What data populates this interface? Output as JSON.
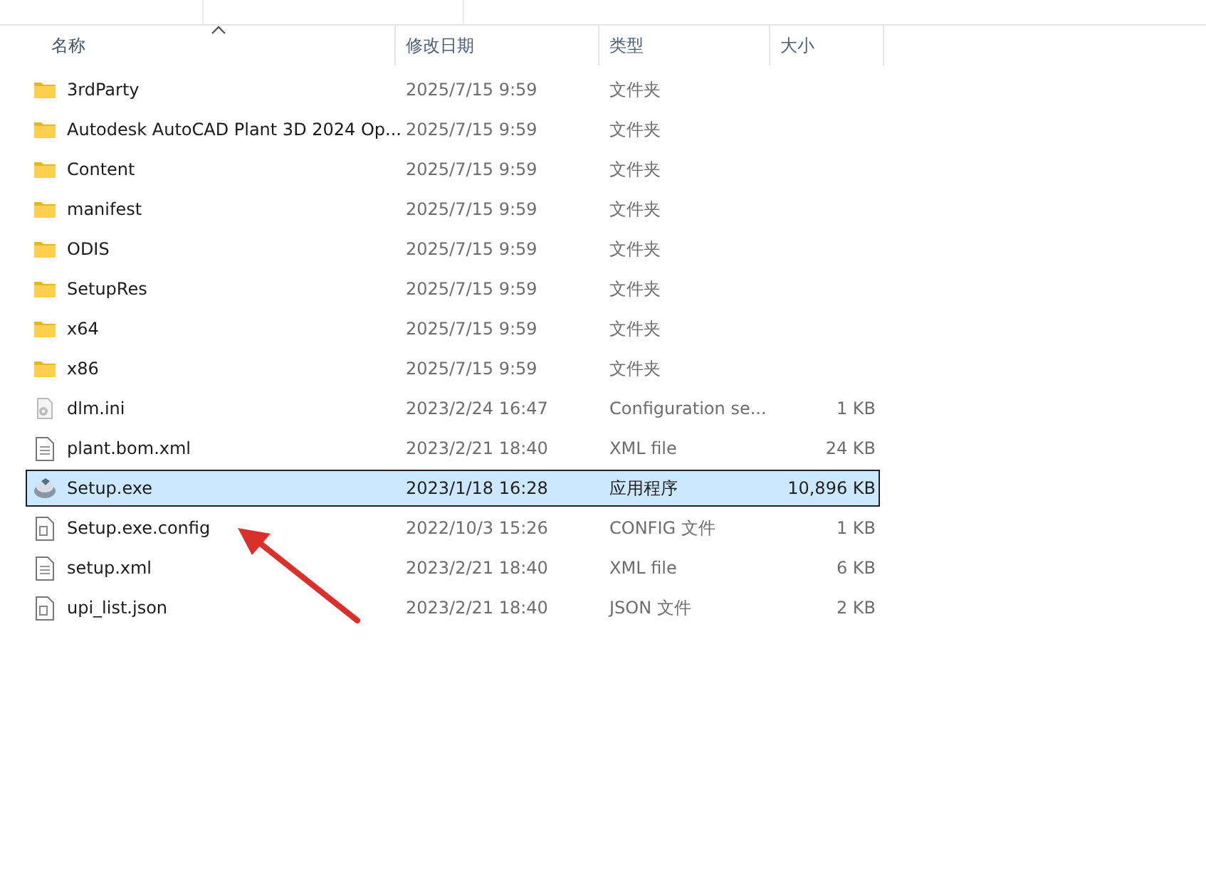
{
  "columns": [
    {
      "label": "名称",
      "sorted": true
    },
    {
      "label": "修改日期",
      "sorted": false
    },
    {
      "label": "类型",
      "sorted": false
    },
    {
      "label": "大小",
      "sorted": false
    }
  ],
  "files": [
    {
      "kind": "folder",
      "name": "3rdParty",
      "date": "2025/7/15 9:59",
      "type": "文件夹",
      "selected": false
    },
    {
      "kind": "folder",
      "name": "Autodesk AutoCAD Plant 3D 2024 Op...",
      "date": "2025/7/15 9:59",
      "type": "文件夹",
      "selected": false
    },
    {
      "kind": "folder",
      "name": "Content",
      "date": "2025/7/15 9:59",
      "type": "文件夹",
      "selected": false
    },
    {
      "kind": "folder",
      "name": "manifest",
      "date": "2025/7/15 9:59",
      "type": "文件夹",
      "selected": false
    },
    {
      "kind": "folder",
      "name": "ODIS",
      "date": "2025/7/15 9:59",
      "type": "文件夹",
      "selected": false
    },
    {
      "kind": "folder",
      "name": "SetupRes",
      "date": "2025/7/15 9:59",
      "type": "文件夹",
      "selected": false
    },
    {
      "kind": "folder",
      "name": "x64",
      "date": "2025/7/15 9:59",
      "type": "文件夹",
      "selected": false
    },
    {
      "kind": "folder",
      "name": "x86",
      "date": "2025/7/15 9:59",
      "type": "文件夹",
      "selected": false
    },
    {
      "kind": "settings",
      "name": "dlm.ini",
      "date": "2023/2/24 16:47",
      "type": "Configuration se...",
      "size": "1 KB",
      "selected": false
    },
    {
      "kind": "document",
      "name": "plant.bom.xml",
      "date": "2023/2/21 18:40",
      "type": "XML file",
      "size": "24 KB",
      "selected": false
    },
    {
      "kind": "program",
      "name": "Setup.exe",
      "date": "2023/1/18 16:28",
      "type": "应用程序",
      "size": "10,896 KB",
      "selected": true
    },
    {
      "kind": "config",
      "name": "Setup.exe.config",
      "date": "2022/10/3 15:26",
      "type": "CONFIG 文件",
      "size": "1 KB",
      "selected": false
    },
    {
      "kind": "document",
      "name": "setup.xml",
      "date": "2023/2/21 18:40",
      "type": "XML file",
      "size": "6 KB",
      "selected": false
    },
    {
      "kind": "config",
      "name": "upi_list.json",
      "date": "2023/2/21 18:40",
      "type": "JSON 文件",
      "size": "2 KB",
      "selected": false
    }
  ]
}
